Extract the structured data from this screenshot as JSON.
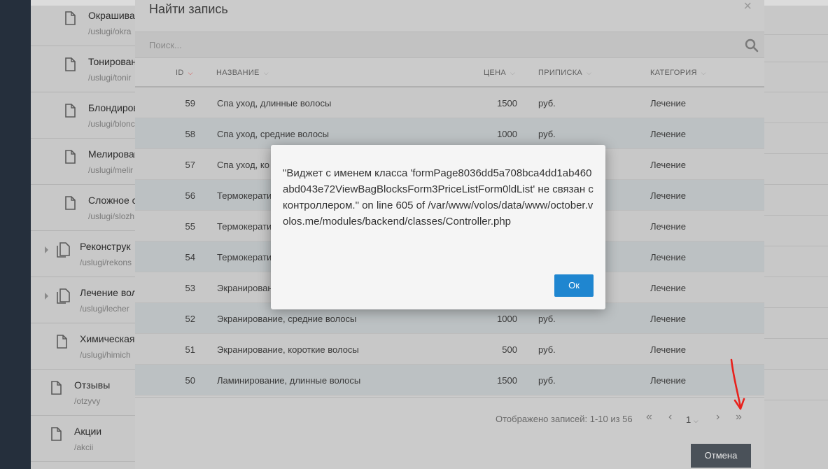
{
  "background_list": [
    {
      "title": "Окрашиван",
      "url": "/uslugi/okra",
      "indent": 2,
      "expandable": false,
      "multi": false
    },
    {
      "title": "Тонирован",
      "url": "/uslugi/tonir",
      "indent": 2,
      "expandable": false,
      "multi": false
    },
    {
      "title": "Блондиров",
      "url": "/uslugi/blonc",
      "indent": 2,
      "expandable": false,
      "multi": false
    },
    {
      "title": "Мелирован",
      "url": "/uslugi/melir",
      "indent": 2,
      "expandable": false,
      "multi": false
    },
    {
      "title": "Сложное с",
      "url": "/uslugi/slozh",
      "indent": 2,
      "expandable": false,
      "multi": false
    },
    {
      "title": "Реконструк",
      "url": "/uslugi/rekons",
      "indent": 1,
      "expandable": true,
      "multi": true
    },
    {
      "title": "Лечение вол",
      "url": "/uslugi/lecher",
      "indent": 1,
      "expandable": true,
      "multi": true
    },
    {
      "title": "Химическая",
      "url": "/uslugi/himich",
      "indent": 1,
      "expandable": false,
      "multi": false
    },
    {
      "title": "Отзывы",
      "url": "/otzyvy",
      "indent": 0,
      "expandable": false,
      "multi": false
    },
    {
      "title": "Акции",
      "url": "/akcii",
      "indent": 0,
      "expandable": false,
      "multi": false
    }
  ],
  "modal": {
    "title": "Найти запись",
    "close": "×",
    "search_placeholder": "Поиск...",
    "columns": [
      {
        "label": "ID",
        "sorted": true
      },
      {
        "label": "НАЗВАНИЕ",
        "sorted": false
      },
      {
        "label": "ЦЕНА",
        "sorted": false
      },
      {
        "label": "ПРИПИСКА",
        "sorted": false
      },
      {
        "label": "КАТЕГОРИЯ",
        "sorted": false
      }
    ],
    "rows": [
      {
        "id": "59",
        "name": "Спа уход, длинные волосы",
        "price": "1500",
        "suffix": "руб.",
        "category": "Лечение"
      },
      {
        "id": "58",
        "name": "Спа уход, средние волосы",
        "price": "1000",
        "suffix": "руб.",
        "category": "Лечение"
      },
      {
        "id": "57",
        "name": "Спа уход, ко",
        "price": "",
        "suffix": "",
        "category": "Лечение"
      },
      {
        "id": "56",
        "name": "Термокерати",
        "price": "",
        "suffix": "",
        "category": "Лечение"
      },
      {
        "id": "55",
        "name": "Термокерати",
        "price": "",
        "suffix": "",
        "category": "Лечение"
      },
      {
        "id": "54",
        "name": "Термокерати",
        "price": "",
        "suffix": "",
        "category": "Лечение"
      },
      {
        "id": "53",
        "name": "Экранирован",
        "price": "",
        "suffix": "",
        "category": "Лечение"
      },
      {
        "id": "52",
        "name": "Экранирование, средние волосы",
        "price": "1000",
        "suffix": "руб.",
        "category": "Лечение"
      },
      {
        "id": "51",
        "name": "Экранирование, короткие волосы",
        "price": "500",
        "suffix": "руб.",
        "category": "Лечение"
      },
      {
        "id": "50",
        "name": "Ламинирование, длинные волосы",
        "price": "1500",
        "suffix": "руб.",
        "category": "Лечение"
      }
    ],
    "records_info": "Отображено записей: 1-10 из 56",
    "page_first": "«",
    "page_prev": "‹",
    "page_current": "1",
    "page_next": "›",
    "page_last": "»",
    "cancel_label": "Отмена"
  },
  "alert": {
    "message": "\"Виджет с именем класса 'formPage8036dd5a708bca4dd1ab460abd043e72ViewBagBlocksForm3PriceListForm0ldList' не связан с контроллером.\" on line 605 of /var/www/volos/data/www/october.volos.me/modules/backend/classes/Controller.php",
    "ok_label": "Ок",
    "button_color": "#1f86d0"
  },
  "annotation_color": "#e8211c"
}
